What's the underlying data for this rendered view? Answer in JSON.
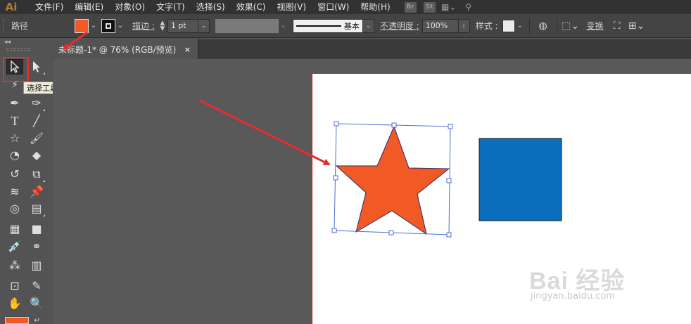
{
  "app": {
    "logo": "Ai"
  },
  "menu": {
    "items": [
      "文件(F)",
      "编辑(E)",
      "对象(O)",
      "文字(T)",
      "选择(S)",
      "效果(C)",
      "视图(V)",
      "窗口(W)",
      "帮助(H)"
    ],
    "right": [
      "Br",
      "St"
    ]
  },
  "control": {
    "path_label": "路径",
    "stroke_label": "描边 :",
    "stroke_value": "1 pt",
    "stroke_style_label": "基本",
    "opacity_label": "不透明度 :",
    "opacity_value": "100%",
    "style_label": "样式 :",
    "transform_label": "变换",
    "fill_color": "#f15a24"
  },
  "document": {
    "tab_title": "未标题-1* @ 76% (RGB/预览)",
    "close": "×"
  },
  "tools": {
    "tooltip": "选择工具 (V)",
    "icons": [
      "selection-tool",
      "direct-selection-tool",
      "magic-wand-tool",
      "lasso-tool",
      "pen-tool",
      "curvature-tool",
      "type-tool",
      "line-tool",
      "star-tool",
      "paintbrush-tool",
      "shaper-tool",
      "eraser-tool",
      "rotate-tool",
      "scale-tool",
      "width-tool",
      "puppet-warp-tool",
      "shape-builder-tool",
      "perspective-grid-tool",
      "mesh-tool",
      "gradient-tool",
      "eyedropper-tool",
      "blend-tool",
      "symbol-sprayer-tool",
      "column-graph-tool",
      "artboard-tool",
      "slice-tool",
      "hand-tool",
      "zoom-tool"
    ]
  },
  "artwork": {
    "star_color": "#f15a24",
    "square_color": "#0a6ebd",
    "annotation_color": "#e52e2e"
  },
  "watermark": {
    "logo": "Bai 经验",
    "url": "jingyan.baidu.com"
  }
}
